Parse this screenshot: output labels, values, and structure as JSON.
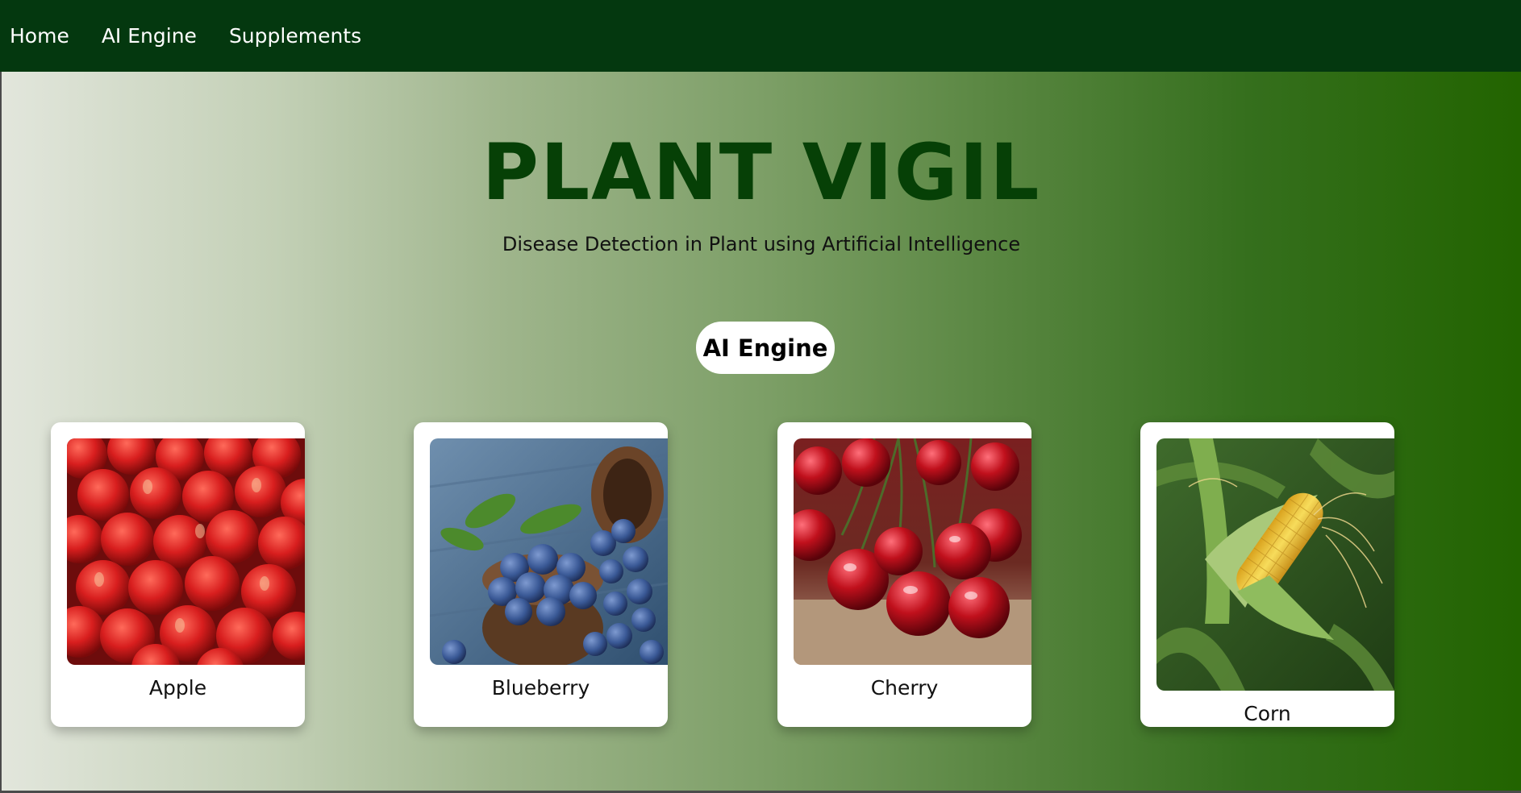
{
  "nav": {
    "items": [
      {
        "label": "Home"
      },
      {
        "label": "AI Engine"
      },
      {
        "label": "Supplements"
      }
    ]
  },
  "hero": {
    "title": "PLANT VIGIL",
    "subtitle": "Disease Detection in Plant using Artificial Intelligence",
    "button_label": "AI Engine"
  },
  "cards": [
    {
      "label": "Apple",
      "image": "apples-photo"
    },
    {
      "label": "Blueberry",
      "image": "blueberries-photo"
    },
    {
      "label": "Cherry",
      "image": "cherries-photo"
    },
    {
      "label": "Corn",
      "image": "corn-photo"
    }
  ],
  "colors": {
    "navbar": "#04380f",
    "title": "#064006",
    "gradient_start": "#e2e6dc",
    "gradient_end": "#226400"
  }
}
